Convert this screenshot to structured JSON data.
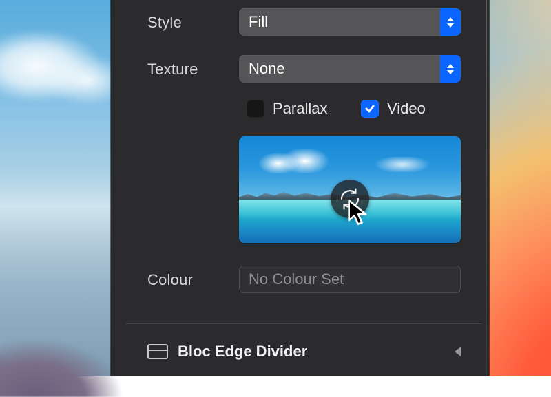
{
  "labels": {
    "style": "Style",
    "texture": "Texture",
    "colour": "Colour"
  },
  "controls": {
    "style_value": "Fill",
    "texture_value": "None",
    "parallax_label": "Parallax",
    "parallax_checked": false,
    "video_label": "Video",
    "video_checked": true,
    "colour_value": "No Colour Set"
  },
  "section": {
    "title": "Bloc Edge Divider"
  }
}
